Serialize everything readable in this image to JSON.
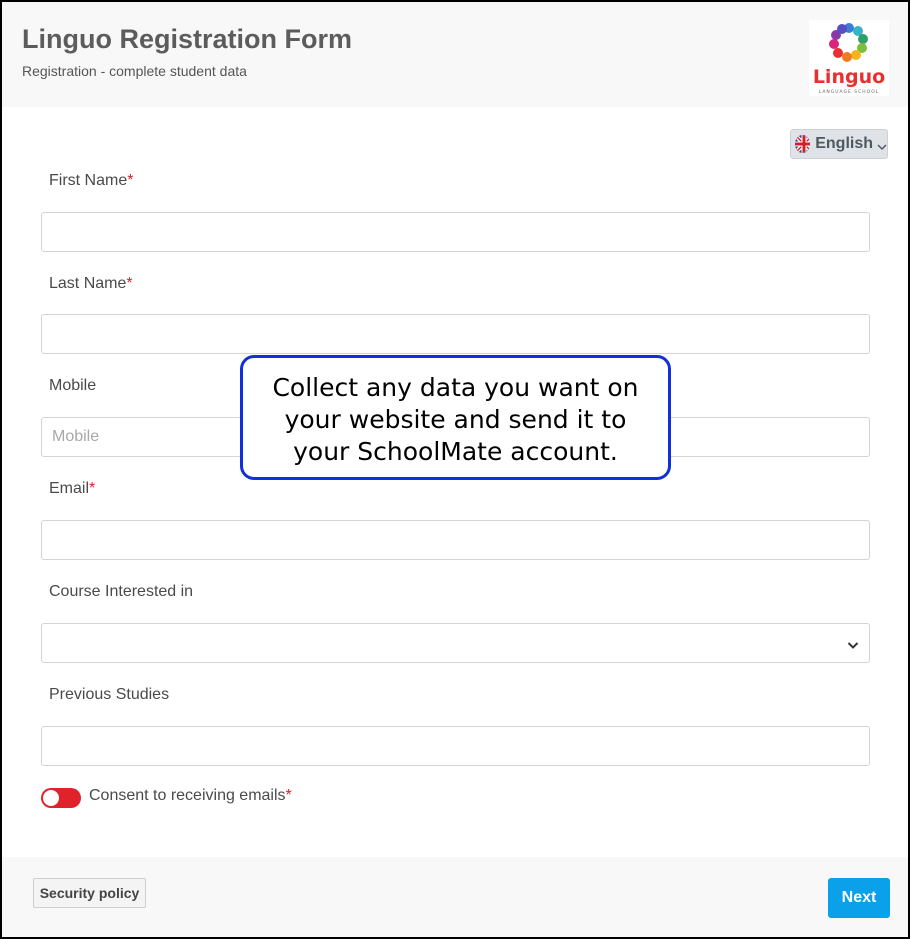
{
  "header": {
    "title": "Linguo Registration Form",
    "subtitle": "Registration - complete student data",
    "logo_text": "Linguo",
    "logo_tagline": "LANGUAGE SCHOOL"
  },
  "language": {
    "selected": "English",
    "flag_icon": "uk-flag-icon"
  },
  "form": {
    "first_name": {
      "label": "First Name",
      "required": "*",
      "value": ""
    },
    "last_name": {
      "label": "Last Name",
      "required": "*",
      "value": ""
    },
    "mobile": {
      "label": "Mobile",
      "placeholder": "Mobile",
      "value": ""
    },
    "email": {
      "label": "Email",
      "required": "*",
      "value": ""
    },
    "course": {
      "label": "Course Interested in",
      "value": ""
    },
    "previous_studies": {
      "label": "Previous Studies",
      "value": ""
    },
    "consent": {
      "label": "Consent to receiving emails",
      "required": "*",
      "toggle_color": "#e0222b"
    }
  },
  "callout": {
    "text_line1": "Collect any data you want on",
    "text_line2": "your website and send it to",
    "text_line3": "your SchoolMate account.",
    "border_color": "#1030d8"
  },
  "footer": {
    "security_label": "Security policy",
    "next_label": "Next",
    "next_color": "#0aa1ea"
  }
}
